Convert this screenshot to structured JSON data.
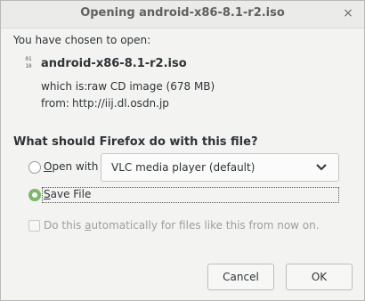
{
  "window": {
    "title": "Opening android-x86-8.1-r2.iso",
    "close_glyph": "×"
  },
  "intro": "You have chosen to open:",
  "file": {
    "icon_glyph": "01\n10",
    "name": "android-x86-8.1-r2.iso",
    "which_is_label": "which is:",
    "which_is_value": "raw CD image (678 MB)",
    "from_label": "from:",
    "from_value": "http://iij.dl.osdn.jp"
  },
  "question": "What should Firefox do with this file?",
  "options": {
    "open_with": {
      "label_mnemonic": "O",
      "label_rest": "pen with",
      "checked": false
    },
    "application": "VLC media player (default)",
    "save_file": {
      "label_mnemonic": "S",
      "label_rest": "ave File",
      "checked": true
    }
  },
  "auto_checkbox": {
    "prefix": "Do this ",
    "mnemonic": "a",
    "rest": "utomatically for files like this from now on.",
    "checked": false,
    "enabled": false
  },
  "buttons": {
    "cancel": "Cancel",
    "ok": "OK"
  },
  "colors": {
    "radio_checked": "#7cb86a",
    "dialog_bg": "#f3f3f2"
  }
}
